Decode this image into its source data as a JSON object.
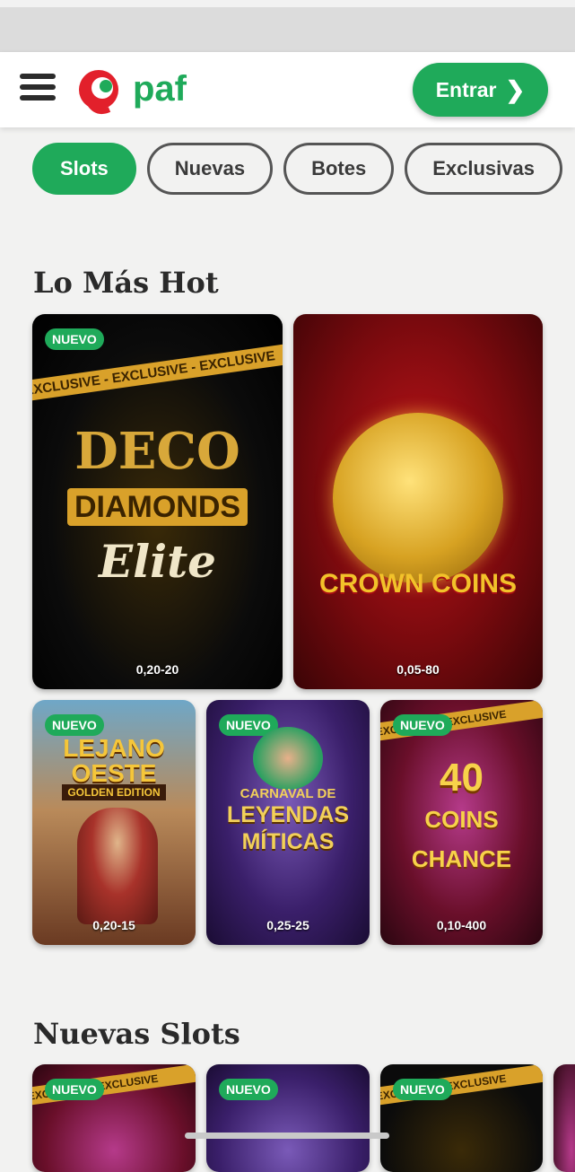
{
  "brand": {
    "name": "paf",
    "accent": "#1faa5a"
  },
  "header": {
    "login_label": "Entrar"
  },
  "tabs": [
    {
      "label": "Slots",
      "active": true
    },
    {
      "label": "Nuevas",
      "active": false
    },
    {
      "label": "Botes",
      "active": false
    },
    {
      "label": "Exclusivas",
      "active": false
    }
  ],
  "sections": {
    "hot": {
      "title": "Lo Más Hot",
      "games": [
        {
          "title_a": "DECO",
          "title_b": "DIAMONDS",
          "title_c": "Elite",
          "badge": "NUEVO",
          "ribbon": "EXCLUSIVE - EXCLUSIVE - EXCLUSIVE",
          "bet": "0,20-20"
        },
        {
          "title_a": "CROWN COINS",
          "bet": "0,05-80"
        },
        {
          "title_a": "LEJANO",
          "title_b": "OESTE",
          "title_c": "GOLDEN EDITION",
          "badge": "NUEVO",
          "bet": "0,20-15"
        },
        {
          "title_a": "CARNAVAL DE",
          "title_b": "LEYENDAS",
          "title_c": "MÍTICAS",
          "badge": "NUEVO",
          "bet": "0,25-25"
        },
        {
          "title_a": "40",
          "title_b": "COINS",
          "title_c": "CHANCE",
          "badge": "NUEVO",
          "ribbon": "EXCLUSIVE - EXCLUSIVE",
          "bet": "0,10-400"
        }
      ]
    },
    "new": {
      "title": "Nuevas Slots",
      "badges": [
        "NUEVO",
        "NUEVO",
        "NUEVO"
      ],
      "ribbon": "EXCLUSIVE - EXCLUSIVE"
    }
  }
}
